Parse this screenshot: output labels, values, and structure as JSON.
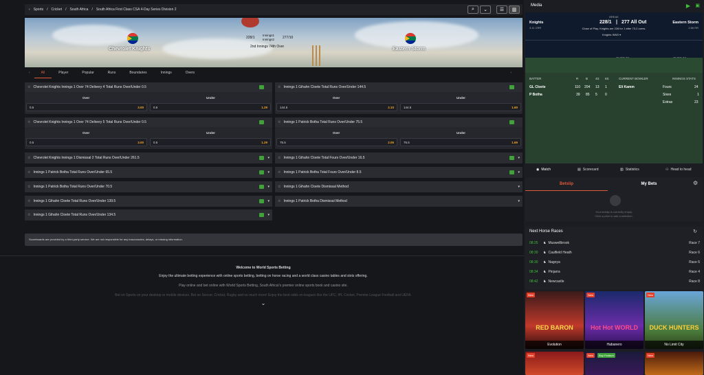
{
  "breadcrumb": [
    "Sports",
    "Cricket",
    "South Africa",
    "South Africa First Class CSA 4-Day Series Division 2"
  ],
  "match": {
    "home": "Chevrolet Knights",
    "away": "Eastern Storm",
    "home_score": "228/1",
    "away_score": "277/10",
    "inn1": "Innings1",
    "inn2": "Innings2",
    "status": "2nd Innings 74th Over"
  },
  "tabs": [
    "All",
    "Player",
    "Popular",
    "Runs",
    "Boundaries",
    "Innings",
    "Overs"
  ],
  "markets": [
    {
      "title": "Chevrolet Knights Innings 1 Over 74 Delivery 4 Total Runs Over/Under 0.5",
      "over_label": "Over",
      "under_label": "Under",
      "over_line": "0.5",
      "over_odds": "3.00",
      "under_line": "0.5",
      "under_odds": "1.29"
    },
    {
      "title": "Innings 1 Gihahn Cloete Total Runs Over/Under 144.5",
      "over_label": "Over",
      "under_label": "Under",
      "over_line": "144.5",
      "over_odds": "2.10",
      "under_line": "144.5",
      "under_odds": "1.60"
    },
    {
      "title": "Chevrolet Knights Innings 1 Over 74 Delivery 5 Total Runs Over/Under 0.5",
      "over_label": "Over",
      "under_label": "Under",
      "over_line": "0.5",
      "over_odds": "3.00",
      "under_line": "0.5",
      "under_odds": "1.29"
    },
    {
      "title": "Innings 1 Patrick Botha Total Runs Over/Under 75.5",
      "over_label": "Over",
      "under_label": "Under",
      "over_line": "75.5",
      "over_odds": "2.05",
      "under_line": "75.5",
      "under_odds": "1.69"
    }
  ],
  "collapsed_left": [
    "Chevrolet Knights Innings 1 Dismissal 2 Total Runs Over/Under 261.5",
    "Innings 1 Patrick Botha Total Runs Over/Under 65.5",
    "Innings 1 Patrick Botha Total Runs Over/Under 70.5",
    "Innings 1 Gihahn Cloete Total Runs Over/Under 139.5",
    "Innings 1 Gihahn Cloete Total Runs Over/Under 134.5"
  ],
  "collapsed_right": [
    "Innings 1 Gihahn Cloete Total Fours Over/Under 16.5",
    "Innings 1 Patrick Botha Total Fours Over/Under 8.5",
    "Innings 1 Gihahn Cloete Dismissal Method",
    "Innings 1 Patrick Botha Dismissal Method"
  ],
  "disclaimer": "Scoreboards are provided by a third-party service. We are not responsible for any inaccuracies, delays, or missing information.",
  "footer": {
    "title": "Welcome to World Sports Betting",
    "p1": "Enjoy the ultimate betting experience with online sports betting, betting on horse racing and a world class casino tables and slots offering.",
    "p2": "Play online and bet online with World Sports Betting, South Africa\\'s premier online sports book and casino site.",
    "p3": "Bet on Sports on your desktop or mobile devices. Bet on Soccer, Cricket, Rugby and so much more! Enjoy the best odds on leagues like the UFC, IPL Cricket, Premier League Football and UEFA."
  },
  "media": {
    "title": "Media",
    "break": "BREAK",
    "home": "Knights",
    "away": "Eastern Storm",
    "home_score": "228/1",
    "away_score": "277 All Out",
    "home_rr": "3.11 CRR",
    "away_rr": "2.66 RR",
    "close": "Close of Play. Knights are 228 for 1 after 73.2 overs.",
    "innings_sel": "Knights INNS",
    "overs": [
      "OVER 72",
      "OVER 73",
      "OVER 74"
    ],
    "batter_h": "BATTER",
    "bowler_h": "CURRENT BOWLER",
    "stats_h": "INNINGS STATS",
    "cols": [
      "R",
      "B",
      "4S",
      "6S"
    ],
    "batters": [
      {
        "name": "GL Cloete",
        "r": "110",
        "b": "204",
        "f": "13",
        "s": "1"
      },
      {
        "name": "P Botha",
        "r": "39",
        "b": "85",
        "f": "5",
        "s": "0"
      }
    ],
    "bowler": "Eli Kamm",
    "stats": [
      {
        "k": "Fours",
        "v": "24"
      },
      {
        "k": "Sixes",
        "v": "1"
      },
      {
        "k": "Extras",
        "v": "23"
      }
    ]
  },
  "rtabs": [
    "Match",
    "Scorecard",
    "Statistics",
    "Head to head"
  ],
  "betslip": {
    "tab1": "Betslip",
    "tab2": "My Bets",
    "empty1": "Your betslip is currently empty.",
    "empty2": "Click a price to add a selection."
  },
  "races": {
    "title": "Next Horse Races",
    "items": [
      {
        "t": "08:25",
        "n": "Muswellbrook",
        "r": "Race 7"
      },
      {
        "t": "08:30",
        "n": "Caulfield Heath",
        "r": "Race 6"
      },
      {
        "t": "08:30",
        "n": "Nagoya",
        "r": "Race 6"
      },
      {
        "t": "08:34",
        "n": "Pinjarra",
        "r": "Race 4"
      },
      {
        "t": "08:42",
        "n": "Newcastle",
        "r": "Race 8"
      }
    ]
  },
  "games": [
    {
      "name": "Evolution",
      "title": "RED BARON",
      "new": "New"
    },
    {
      "name": "Habanero",
      "title": "Hot Hot WORLD",
      "new": "New"
    },
    {
      "name": "No Limit City",
      "title": "DUCK HUNTERS",
      "new": "New"
    }
  ],
  "games2": [
    {
      "new": "New"
    },
    {
      "new": "New",
      "extra": "Buy Feature"
    },
    {
      "new": "New"
    }
  ]
}
